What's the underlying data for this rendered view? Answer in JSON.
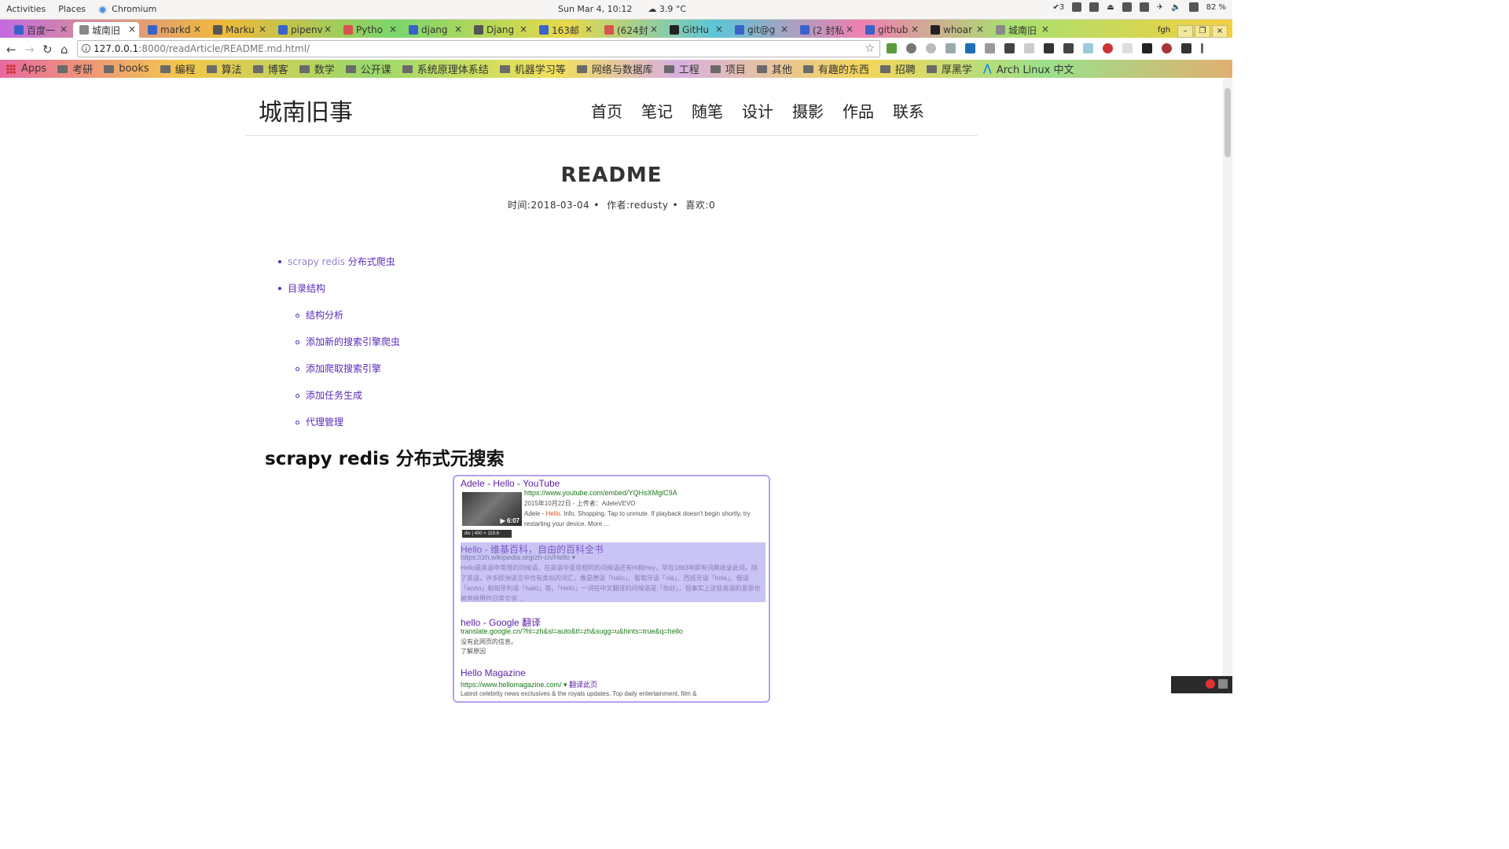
{
  "system_bar": {
    "activities": "Activities",
    "places": "Places",
    "app": "Chromium",
    "datetime": "Sun Mar  4, 10:12",
    "weather": "3.9 °C",
    "notif_count": "3",
    "battery": "82 %"
  },
  "tabs": [
    {
      "label": "百度一",
      "color": "#3a62c8"
    },
    {
      "label": "城南旧",
      "color": "#888888",
      "active": true
    },
    {
      "label": "markd",
      "color": "#3a62c8"
    },
    {
      "label": "Marku",
      "color": "#555555"
    },
    {
      "label": "pipenv",
      "color": "#3a62c8"
    },
    {
      "label": "Pytho",
      "color": "#d9534f"
    },
    {
      "label": "djang",
      "color": "#3a62c8"
    },
    {
      "label": "Djang",
      "color": "#555555"
    },
    {
      "label": "163邮",
      "color": "#3a62c8"
    },
    {
      "label": "(624封",
      "color": "#d9534f"
    },
    {
      "label": "GitHu",
      "color": "#222222"
    },
    {
      "label": "git@g",
      "color": "#3a62c8"
    },
    {
      "label": "(2 封私",
      "color": "#3a62c8"
    },
    {
      "label": "github",
      "color": "#3a62c8"
    },
    {
      "label": "whoar",
      "color": "#222222"
    },
    {
      "label": "城南旧",
      "color": "#888888"
    }
  ],
  "profile_label": "fgh",
  "address": {
    "host": "127.0.0.1",
    "path": ":8000/readArticle/README.md.html/"
  },
  "bookmarks": [
    {
      "label": "Apps",
      "type": "apps"
    },
    {
      "label": "考研",
      "type": "folder"
    },
    {
      "label": "books",
      "type": "folder"
    },
    {
      "label": "编程",
      "type": "folder"
    },
    {
      "label": "算法",
      "type": "folder"
    },
    {
      "label": "博客",
      "type": "folder"
    },
    {
      "label": "数学",
      "type": "folder"
    },
    {
      "label": "公开课",
      "type": "folder"
    },
    {
      "label": "系统原理体系结",
      "type": "folder"
    },
    {
      "label": "机器学习等",
      "type": "folder"
    },
    {
      "label": "网络与数据库",
      "type": "folder"
    },
    {
      "label": "工程",
      "type": "folder"
    },
    {
      "label": "项目",
      "type": "folder"
    },
    {
      "label": "其他",
      "type": "folder"
    },
    {
      "label": "有趣的东西",
      "type": "folder"
    },
    {
      "label": "招聘",
      "type": "folder"
    },
    {
      "label": "厚黑学",
      "type": "folder"
    },
    {
      "label": "Arch Linux 中文",
      "type": "arch"
    }
  ],
  "site": {
    "title": "城南旧事",
    "nav": [
      "首页",
      "笔记",
      "随笔",
      "设计",
      "摄影",
      "作品",
      "联系"
    ]
  },
  "article": {
    "title": "README",
    "date": "时间:2018-03-04",
    "author": "作者:redusty",
    "likes": "喜欢:0",
    "toc_top1_a": "scrapy redis",
    "toc_top1_b": " 分布式爬虫",
    "toc_top2": "目录结构",
    "toc_sub": [
      "结构分析",
      "添加新的搜索引擎爬虫",
      "添加爬取搜索引擎",
      "添加任务生成",
      "代理管理"
    ],
    "h2": "scrapy redis 分布式元搜索"
  },
  "embedded_results": [
    {
      "title": "Adele - Hello - YouTube",
      "url": "https://www.youtube.com/embed/YQHsXMglC9A",
      "meta": "2015年10月22日 - 上传者：AdeleVEVO",
      "desc_a": "Adele - ",
      "desc_hl": "Hello",
      "desc_b": ". Info. Shopping. Tap to unmute. If playback doesn't begin shortly, try restarting your device. More ...",
      "duration": "▶ 6:07",
      "tooltip": "div | 400 × 119.6"
    },
    {
      "title": "Hello - 维基百科，自由的百科全书",
      "url": "https://zh.wikipedia.org/zh-cn/Hello ▾",
      "desc": "Hello是英语中常用的问候语，在英语中意思相同的问候语还有Hi和Hey，早在1883年即有词典收录此词。除了英语，许多欧洲语言中也有类似的词汇，像是德语「hallo」、葡萄牙语「olá」、西班牙语「hola」、俄语「алло」和匈牙利语「halló」等。「Hello」一词在中文翻译的问候语是「你好」，但事实上这些英语的意思也被直接用作日常交谈 ..."
    },
    {
      "title": "hello - Google 翻译",
      "url": "translate.google.cn/?hl=zh&sl=auto&tl=zh&sugg=u&hints=true&q=hello",
      "desc1": "没有此网页的信息。",
      "desc2": "了解原因"
    },
    {
      "title": "Hello Magazine",
      "url": "https://www.hellomagazine.com/ ▾",
      "translate": "翻译此页",
      "desc": "Latest celebrity news exclusives & the royals updates. Top daily entertainment, film &"
    }
  ]
}
